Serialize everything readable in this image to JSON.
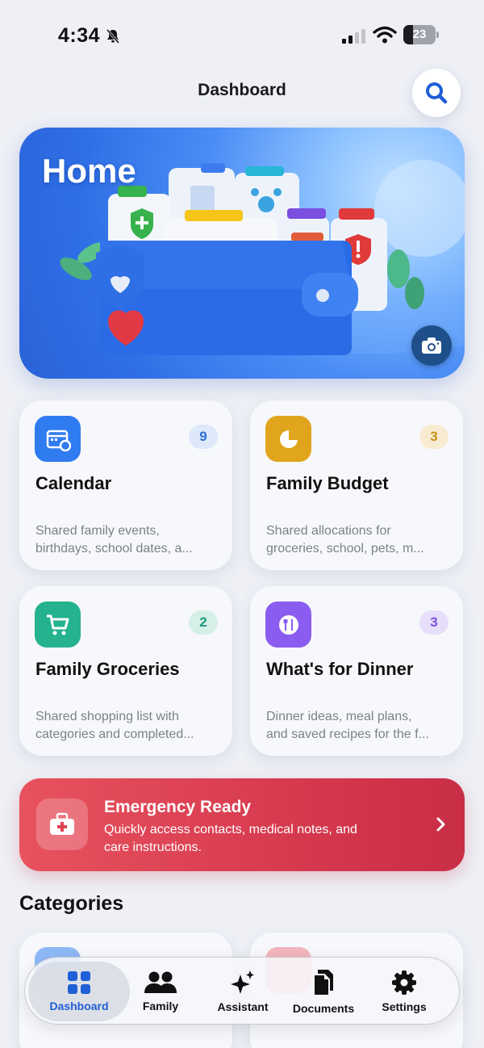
{
  "status": {
    "time": "4:34",
    "battery": "23"
  },
  "header": {
    "title": "Dashboard"
  },
  "hero": {
    "title": "Home"
  },
  "cards": [
    {
      "title": "Calendar",
      "badge": "9",
      "line1": "Shared family events,",
      "line2": "birthdays, school dates, a...",
      "color": "#2f7bf0",
      "badge_bg": "#dde8fb",
      "badge_fg": "#2f6fd8"
    },
    {
      "title": "Family Budget",
      "badge": "3",
      "line1": "Shared allocations for",
      "line2": "groceries, school, pets, m...",
      "color": "#e0a51c",
      "badge_bg": "#f7ecd2",
      "badge_fg": "#c9921a"
    },
    {
      "title": "Family Groceries",
      "badge": "2",
      "line1": "Shared shopping list with",
      "line2": "categories and completed...",
      "color": "#25b38f",
      "badge_bg": "#d6efe7",
      "badge_fg": "#1f9a7b"
    },
    {
      "title": "What's for Dinner",
      "badge": "3",
      "line1": "Dinner ideas, meal plans,",
      "line2": "and saved recipes for the f...",
      "color": "#8b5cf0",
      "badge_bg": "#e6defa",
      "badge_fg": "#7a4fe0"
    }
  ],
  "emergency": {
    "title": "Emergency Ready",
    "line1": "Quickly access contacts, medical notes, and",
    "line2": "care instructions."
  },
  "categories": {
    "title": "Categories"
  },
  "tabs": [
    {
      "label": "Dashboard",
      "icon": "grid-icon"
    },
    {
      "label": "Family",
      "icon": "people-icon"
    },
    {
      "label": "Assistant",
      "icon": "sparkles-icon"
    },
    {
      "label": "Documents",
      "icon": "documents-icon"
    },
    {
      "label": "Settings",
      "icon": "gear-icon"
    }
  ]
}
